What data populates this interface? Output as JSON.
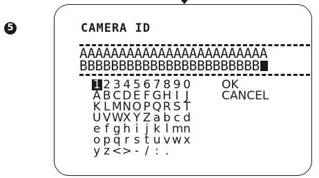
{
  "step": "5",
  "screen": {
    "title": "CAMERA ID",
    "id_line_1": "AAAAAAAAAAAAAAAAAAAAAAAA",
    "id_line_2": "BBBBBBBBBBBBBBBBBBBBBBB"
  },
  "keyboard": {
    "rows": [
      [
        "1",
        "2",
        "3",
        "4",
        "5",
        "6",
        "7",
        "8",
        "9",
        "0"
      ],
      [
        "A",
        "B",
        "C",
        "D",
        "E",
        "F",
        "G",
        "H",
        "I",
        "J"
      ],
      [
        "K",
        "L",
        "M",
        "N",
        "O",
        "P",
        "Q",
        "R",
        "S",
        "T"
      ],
      [
        "U",
        "V",
        "W",
        "X",
        "Y",
        "Z",
        "a",
        "b",
        "c",
        "d"
      ],
      [
        "e",
        "f",
        "g",
        "h",
        "i",
        "j",
        "k",
        "l",
        "m",
        "n"
      ],
      [
        "o",
        "p",
        "q",
        "r",
        "s",
        "t",
        "u",
        "v",
        "w",
        "x"
      ],
      [
        "y",
        "z",
        "<",
        ">",
        "-",
        "/",
        ":",
        "."
      ]
    ],
    "selected": "1",
    "ok_label": "OK",
    "cancel_label": "CANCEL"
  }
}
